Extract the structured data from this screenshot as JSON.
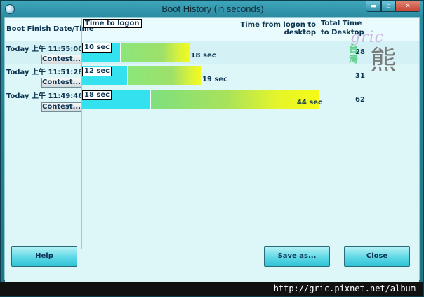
{
  "window": {
    "title": "Boot History (in seconds)",
    "controls": {
      "minimize": "▬",
      "maximize": "▫",
      "close": "✕"
    }
  },
  "columns": {
    "date": "Boot Finish Date/Time",
    "logon": "Time to logon",
    "desktop": "Time from logon to desktop",
    "total": "Total Time to Desktop"
  },
  "rows": [
    {
      "date": "Today  上午 11:55:00",
      "contest": "Contest...",
      "logon_label": "10 sec",
      "logon_sec": 10,
      "desktop_label": "18 sec",
      "desktop_sec": 18,
      "total": "28"
    },
    {
      "date": "Today  上午 11:51:28",
      "contest": "Contest...",
      "logon_label": "12 sec",
      "logon_sec": 12,
      "desktop_label": "19 sec",
      "desktop_sec": 19,
      "total": "31"
    },
    {
      "date": "Today  上午 11:49:46",
      "contest": "Contest...",
      "logon_label": "18 sec",
      "logon_sec": 18,
      "desktop_label": "44 sec",
      "desktop_sec": 44,
      "total": "62"
    }
  ],
  "buttons": {
    "help": "Help",
    "save_as": "Save as...",
    "close": "Close"
  },
  "watermark": {
    "brand": "gric",
    "region": "台灣",
    "char": "熊"
  },
  "footer_url": "http://gric.pixnet.net/album",
  "colors": {
    "logon_bar": "#33e1ef",
    "desktop_bar_start": "#8be67a",
    "desktop_bar_end": "#f5fb14"
  }
}
